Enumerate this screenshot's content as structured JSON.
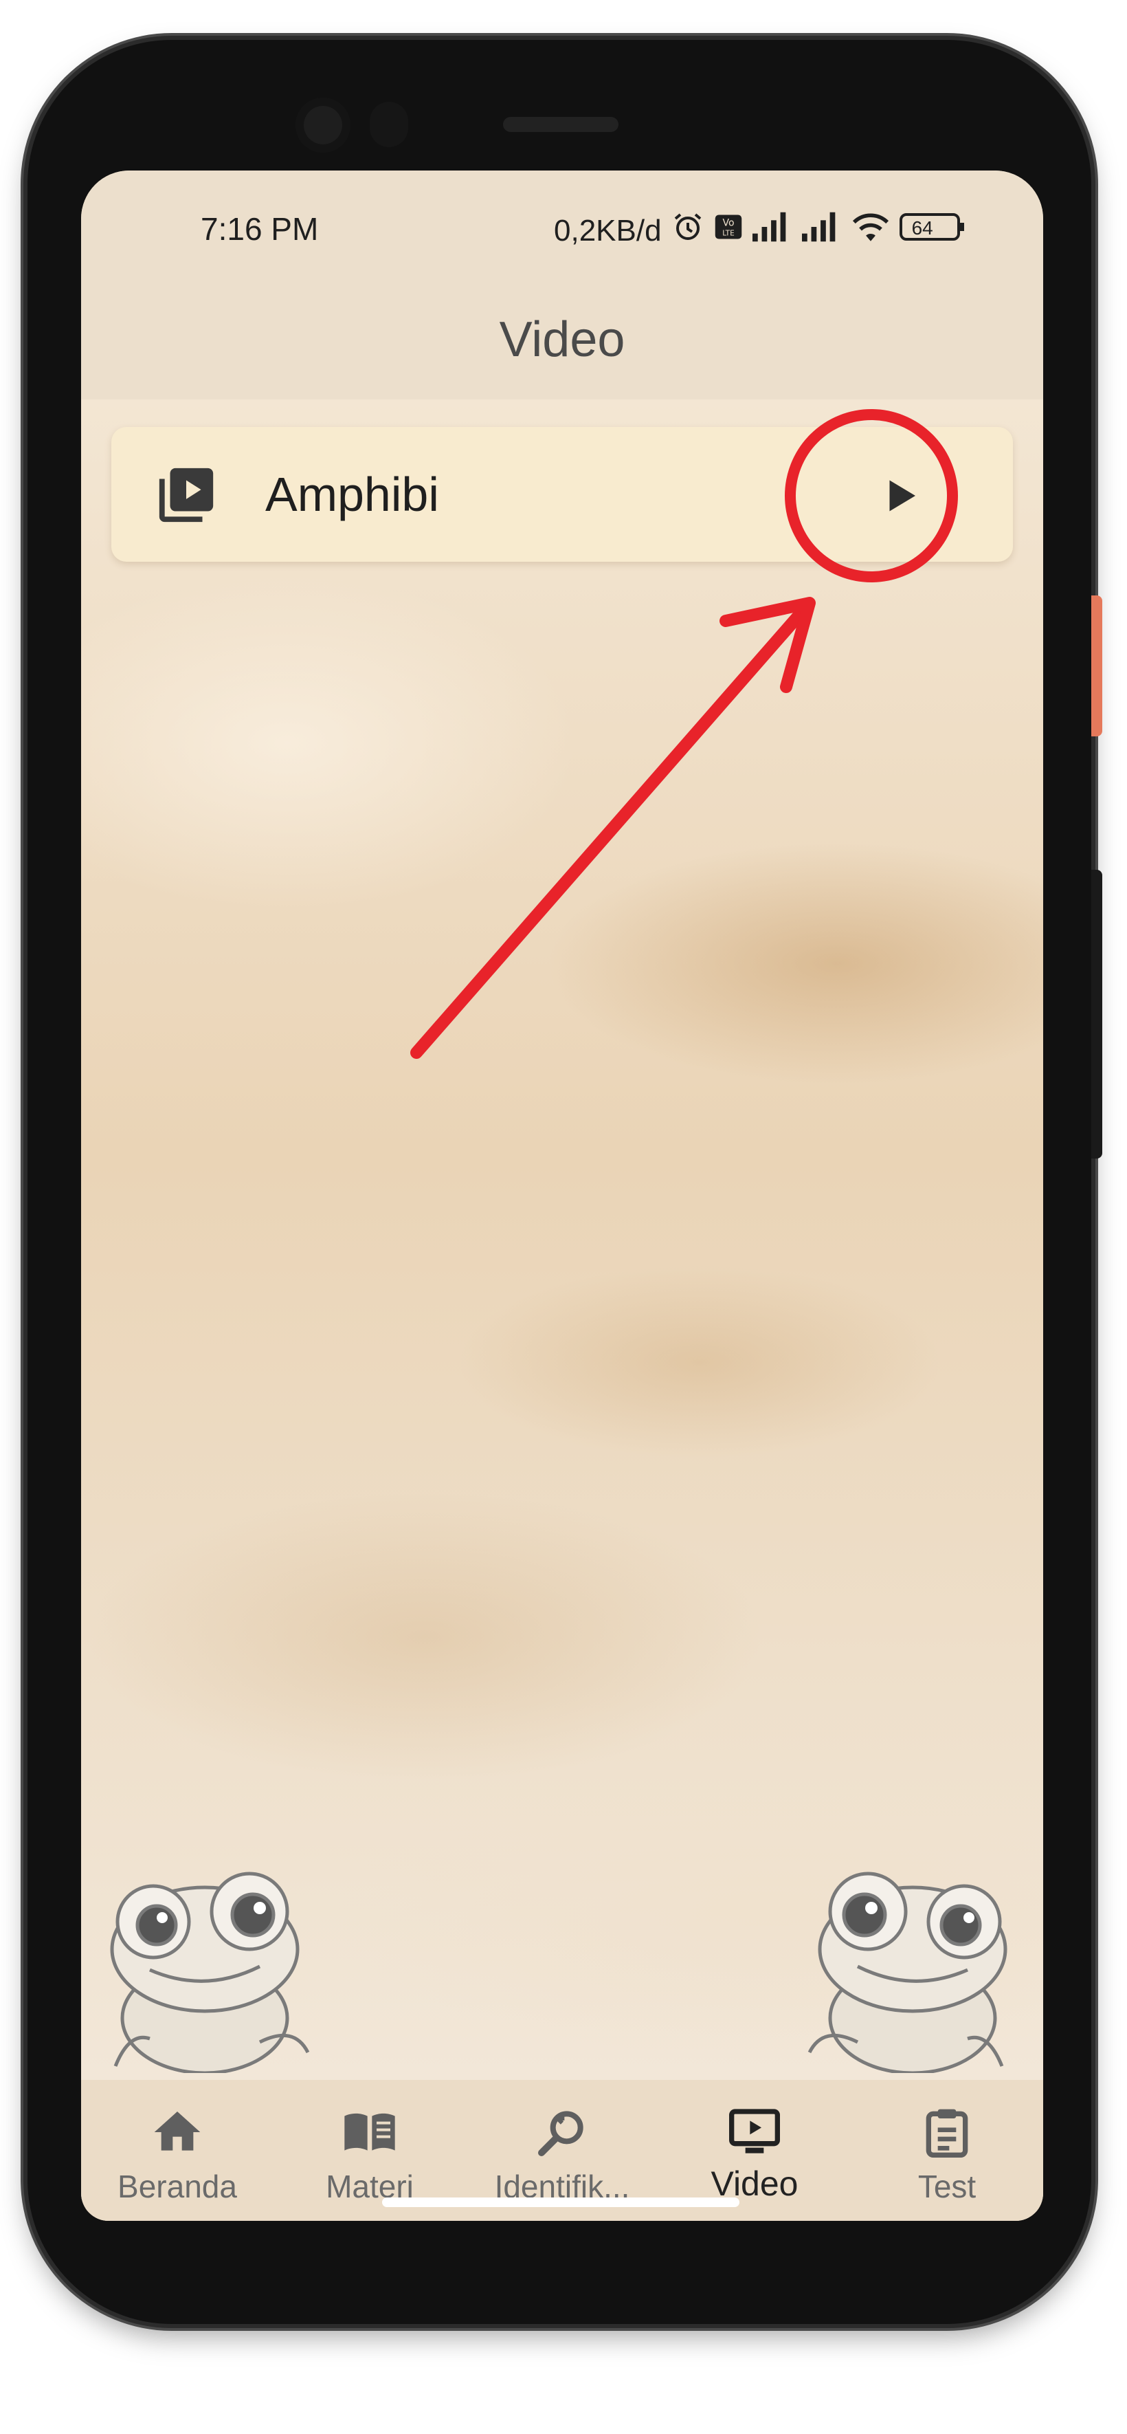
{
  "status_bar": {
    "time": "7:16 PM",
    "data_rate": "0,2KB/d",
    "battery": "64",
    "icons": [
      "alarm-icon",
      "volte-icon",
      "signal-icon",
      "signal-icon",
      "wifi-icon",
      "battery-icon"
    ]
  },
  "app_bar": {
    "title": "Video"
  },
  "video_list": [
    {
      "title": "Amphibi",
      "icon": "video-library-icon",
      "action_icon": "play-icon"
    }
  ],
  "bottom_nav": {
    "items": [
      {
        "label": "Beranda",
        "icon": "home-icon"
      },
      {
        "label": "Materi",
        "icon": "book-icon"
      },
      {
        "label": "Identifik...",
        "icon": "search-zoom-icon"
      },
      {
        "label": "Video",
        "icon": "tv-play-icon",
        "active": true
      },
      {
        "label": "Test",
        "icon": "clipboard-icon"
      }
    ]
  },
  "colors": {
    "accent_annotation": "#e8232a",
    "card_bg": "#f8ebcf",
    "nav_bg": "#ebdcc7",
    "text_dark": "#1f1f1f"
  }
}
